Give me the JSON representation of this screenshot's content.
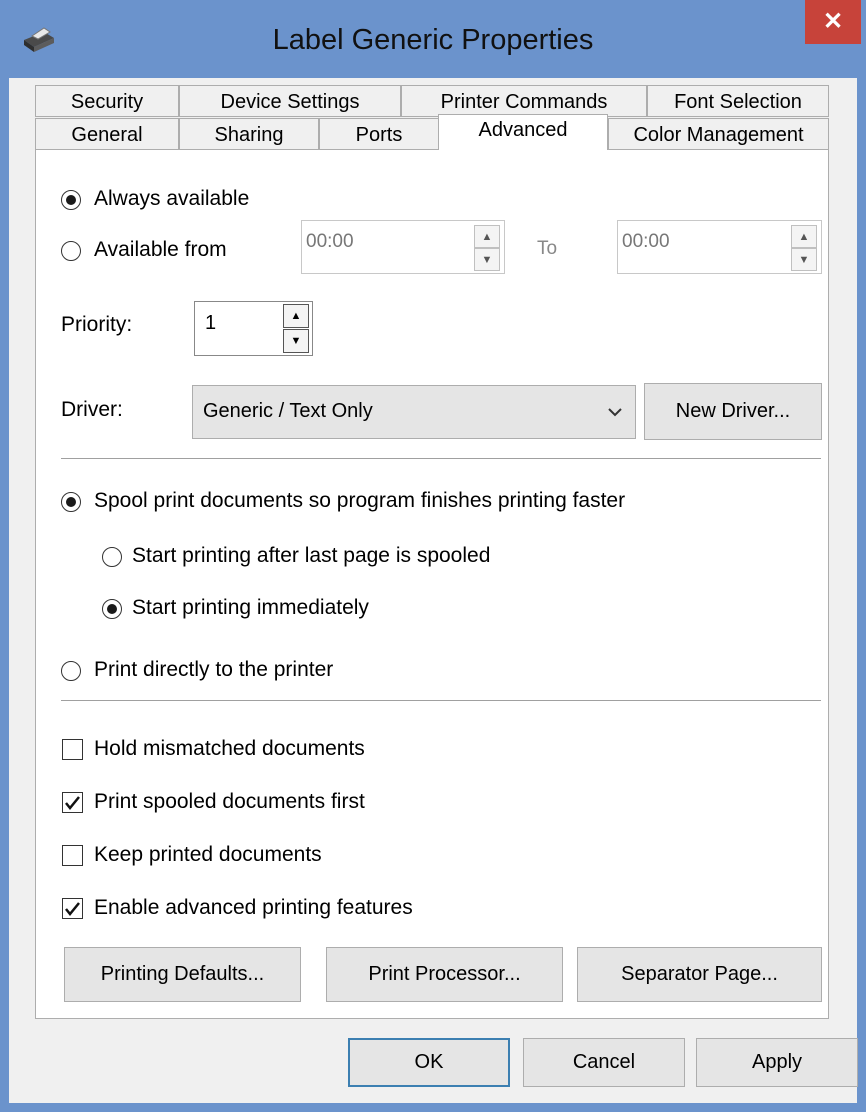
{
  "window": {
    "title": "Label Generic Properties",
    "close_glyph": "✕"
  },
  "tabs_row1": [
    "Security",
    "Device Settings",
    "Printer Commands",
    "Font Selection"
  ],
  "tabs_row2": [
    "General",
    "Sharing",
    "Ports",
    "Advanced",
    "Color Management"
  ],
  "active_tab": "Advanced",
  "availability": {
    "always_label": "Always available",
    "from_label": "Available from",
    "from_value": "00:00",
    "to_label": "To",
    "to_value": "00:00",
    "selected": "always"
  },
  "priority": {
    "label": "Priority:",
    "value": "1"
  },
  "driver": {
    "label": "Driver:",
    "value": "Generic / Text Only",
    "new_driver_label": "New Driver..."
  },
  "spool": {
    "spool_label": "Spool print documents so program finishes printing faster",
    "after_last_label": "Start printing after last page is spooled",
    "immediately_label": "Start printing immediately",
    "direct_label": "Print directly to the printer",
    "selected_mode": "spool",
    "selected_start": "immediately"
  },
  "options": [
    {
      "label": "Hold mismatched documents",
      "checked": false
    },
    {
      "label": "Print spooled documents first",
      "checked": true
    },
    {
      "label": "Keep printed documents",
      "checked": false
    },
    {
      "label": "Enable advanced printing features",
      "checked": true
    }
  ],
  "panel_buttons": {
    "defaults": "Printing Defaults...",
    "processor": "Print Processor...",
    "separator": "Separator Page..."
  },
  "dialog_buttons": {
    "ok": "OK",
    "cancel": "Cancel",
    "apply": "Apply"
  },
  "colors": {
    "titlebar": "#6b93cc",
    "close": "#c7433a",
    "default_button_border": "#3c7fb1"
  }
}
